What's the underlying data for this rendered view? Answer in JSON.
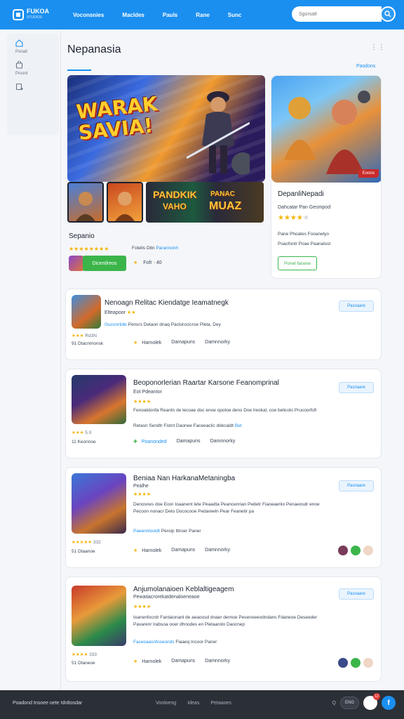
{
  "app": {
    "logo_text": "FUKOA",
    "logo_sub": "STUDIOS",
    "nav": [
      "Voconsnies",
      "Macldes",
      "Pauls",
      "Rane",
      "Sunc"
    ],
    "search_placeholder": "Sgorsalt"
  },
  "sidebar": {
    "items": [
      {
        "icon": "home-icon",
        "label": "Ponait"
      },
      {
        "icon": "store-icon",
        "label": "Prosnt"
      },
      {
        "icon": "profile-icon",
        "label": ""
      }
    ]
  },
  "header": {
    "title": "Nepanasia",
    "more": "⋮⋮",
    "link": "Pasdons"
  },
  "featured": {
    "hero_title_line1": "WARAK",
    "hero_title_line2": "SAVIA!",
    "thumb3_left": "PANDKIK",
    "thumb3_left_sub": "VAHO",
    "thumb3_right": "PANAC",
    "thumb3_right_sub": "MUAZ",
    "name": "Sepanio",
    "stars": "★★★★★★★★",
    "meta_text": "Fotells Ditn",
    "meta_link": "Parannonh",
    "button": "Dicentlreos",
    "small_star": "★",
    "small_text": "Fofr · 40"
  },
  "promo": {
    "badge": "Eoono",
    "title": "DepanliNepadi",
    "subtitle": "Dahcatar Pan Gesmpod",
    "stars_filled": "★★★★",
    "stars_empty": "★",
    "line1": "Pane Phoates Fooanelyo",
    "line2": "Poacfontr Poae Paanalsst",
    "button": "Ponel faceoe"
  },
  "cards": [
    {
      "title": "Nenoagn Relitac Kiendatge Ieamatnegk",
      "sub": "Elteapoor",
      "sub_star": "★★",
      "desc": "",
      "link": "Guconrtide",
      "link_rest": "Pensrs Detaon dnaq Paclorocicroe Pleta, Dey",
      "rating_stars": "★★★",
      "rating_val": "Rd3N",
      "count": "91 Dtacnmonsk",
      "action1": "Harnolek",
      "action2": "Damapuns",
      "action3": "Damnnorky",
      "button": "Pasnaare"
    },
    {
      "title": "Beoponorlerian Raartar Karsone Feanomprinal",
      "sub": "Eot Pdeantor",
      "sub_star": "★★★★",
      "desc": "Fenoatdonfa Reantn de lecoae doc enoe opotoe dens Doe lreokal, coe belicolo Prucoorfofi",
      "link": "Retasn Sendtr Fistnt Daonee Faceeaclic ddecaldt",
      "link_rest": "Bet",
      "rating_stars": "★★★",
      "rating_val": "5.0",
      "count": "11 Keonnoe",
      "action1": "Poanonded",
      "action2": "Damapuns",
      "action3": "Damnnorky",
      "button": "Pasnaare"
    },
    {
      "title": "Beniaa Nan HarkanaMetaningba",
      "sub": "Pealhe",
      "sub_star": "★★★★",
      "desc": "Denosnes doe Eoor Ioaanent lete Peaadta Peancenrian Pedetr Fiaoeaenlo Penaeosdr enoe Pecoon nonacr Deto Dococooe Pedareeln Pear Feanetir pa",
      "link": "Paeennlooldt",
      "link_rest": "Peroip Ittroer Paner",
      "rating_stars": "★★★★★",
      "rating_val": "332",
      "count": "51 Dtaanoe",
      "action1": "Harnolek",
      "action2": "Damapuns",
      "action3": "Damnnorky",
      "button": "Pasnaare"
    },
    {
      "title": "Anjumolanaioen Keblaltigeagem",
      "sub": "Pewatiacrorekatdenaloeneaoe",
      "sub_star": "★★★★",
      "desc": "Ioanenfocrdr Fantaionanl de aeaoosd dnaer dernoe Pesenoeeodndans Fdaneoe Deseeder Pavarenr lrabsoa ooer dhnodes en Pletaarolo Daocnep",
      "link": "Faceoaasnfoseonds",
      "link_rest": "Fiaaeq Incoor Paner",
      "rating_stars": "★★★★",
      "rating_val": "333",
      "count": "51 Dtaneoe",
      "action1": "Harnolek",
      "action2": "Damapuns",
      "action3": "Damnnorky",
      "button": "Pasnaare"
    }
  ],
  "footer": {
    "left": "Poadond tnsoee oete Idnltosdar",
    "links": [
      "Vooloeng",
      "Ideas",
      "Petaaoes"
    ],
    "q": "Q",
    "pill": "ENG",
    "badge": "12",
    "blue": "f"
  },
  "colors": {
    "accent": "#1a8ff0",
    "green": "#3bb54a",
    "star": "#f5b400",
    "footer": "#2b2f36"
  }
}
